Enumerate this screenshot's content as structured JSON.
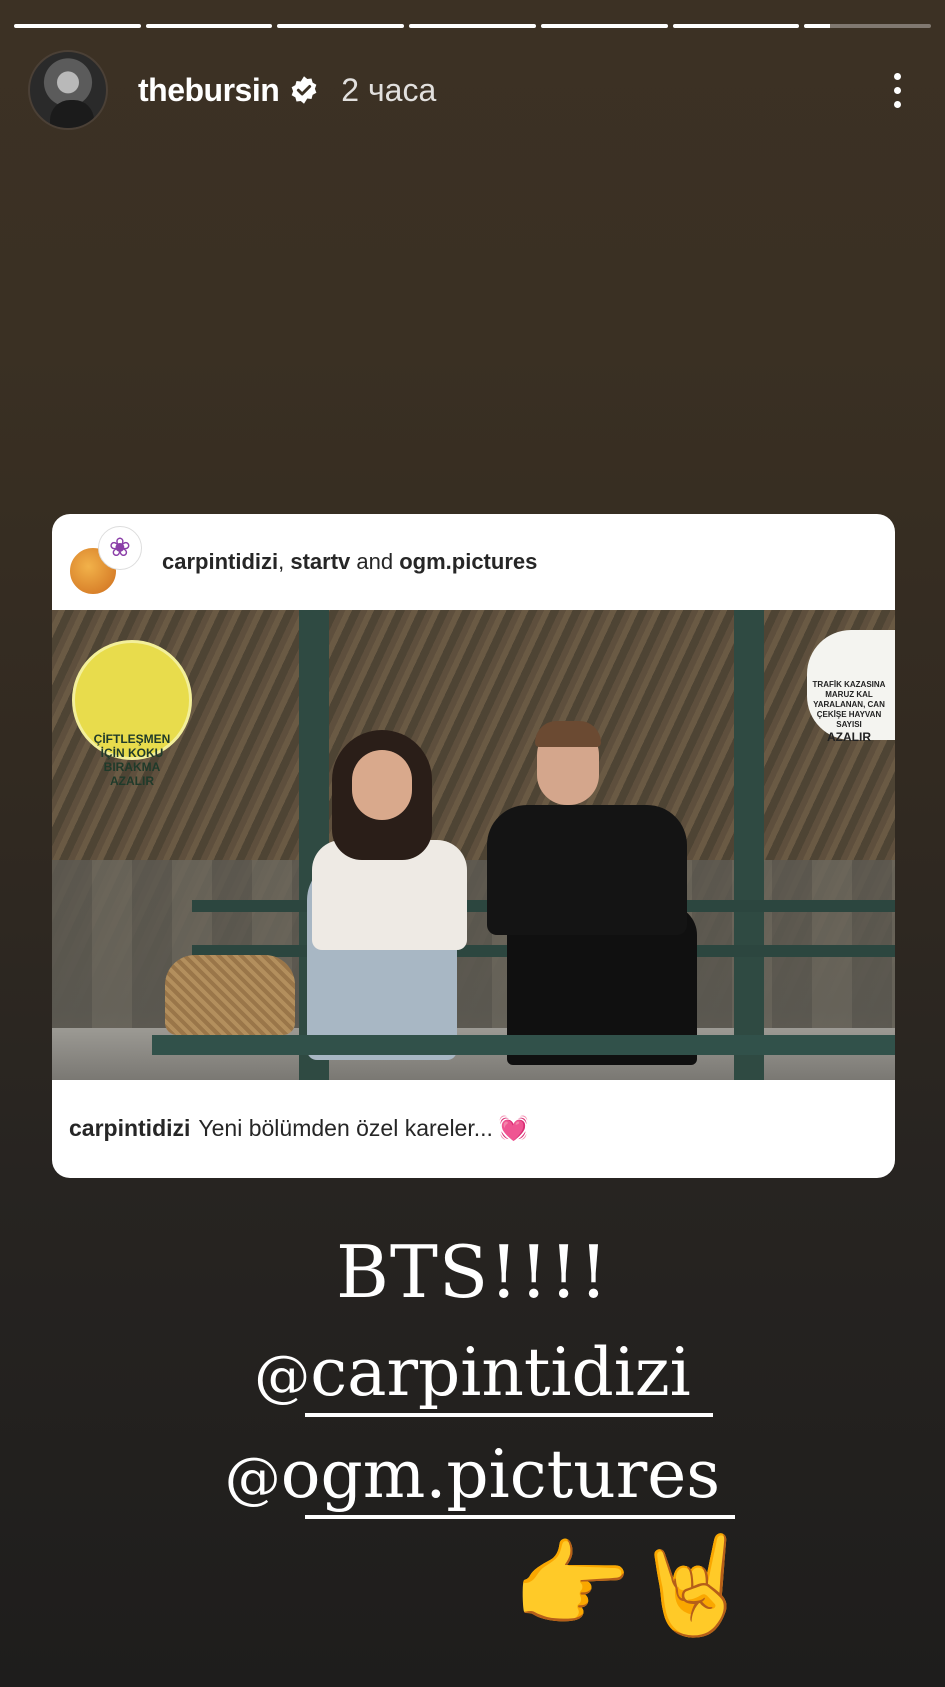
{
  "story": {
    "progress_segments": 7,
    "progress_filled": 6,
    "progress_current_fill": 0.2
  },
  "header": {
    "username": "thebursin",
    "time": "2 часа"
  },
  "card": {
    "authors": {
      "a1": "carpintidizi",
      "sep1": ", ",
      "a2": "startv",
      "sep2": " and ",
      "a3": "ogm.pictures"
    },
    "caption_user": "carpintidizi",
    "caption_text": "Yeni bölümden özel kareler...",
    "caption_emoji": "💓",
    "sign_left_text": "ÇİFTLEŞMEN İÇİN KOKU BIRAKMA AZALIR",
    "sign_right_text": "TRAFİK KAZASINA MARUZ KAL YARALANAN, CAN ÇEKİŞE HAYVAN SAYISI",
    "sign_right_big": "AZALIR"
  },
  "overlay": {
    "bts": "BTS!!!!",
    "mention1_at": "@",
    "mention1": "carpintidizi",
    "mention2_at": "@",
    "mention2": "ogm.pictures",
    "emoji1": "👉",
    "emoji2": "🤘"
  },
  "icons": {
    "verified": "verified-badge-icon",
    "more": "more-vertical-icon"
  }
}
